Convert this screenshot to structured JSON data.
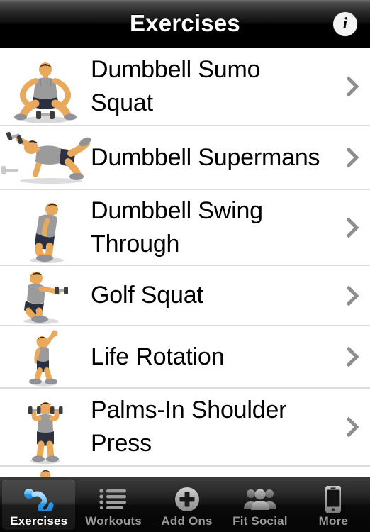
{
  "header": {
    "title": "Exercises",
    "info_button": {
      "name": "info-icon",
      "glyph": "i"
    }
  },
  "list": {
    "items": [
      {
        "title": "Dumbbell Sumo Squat",
        "thumbnail": "sumo-squat-figure",
        "accessory": "disclosure-chevron"
      },
      {
        "title": "Dumbbell Supermans",
        "thumbnail": "supermans-figure",
        "accessory": "disclosure-chevron"
      },
      {
        "title": "Dumbbell Swing Through",
        "thumbnail": "swing-through-figure",
        "accessory": "disclosure-chevron"
      },
      {
        "title": "Golf Squat",
        "thumbnail": "golf-squat-figure",
        "accessory": "disclosure-chevron"
      },
      {
        "title": "Life Rotation",
        "thumbnail": "life-rotation-figure",
        "accessory": "disclosure-chevron"
      },
      {
        "title": "Palms-In Shoulder Press",
        "thumbnail": "shoulder-press-figure",
        "accessory": "disclosure-chevron"
      }
    ]
  },
  "tabbar": {
    "selected": "Exercises",
    "tabs": [
      {
        "label": "Exercises",
        "icon": "sit-up-person-icon",
        "active": true
      },
      {
        "label": "Workouts",
        "icon": "bulleted-list-icon",
        "active": false
      },
      {
        "label": "Add Ons",
        "icon": "plus-circle-icon",
        "active": false
      },
      {
        "label": "Fit Social",
        "icon": "people-group-icon",
        "active": false
      },
      {
        "label": "More",
        "icon": "iphone-icon",
        "active": false
      }
    ]
  },
  "colors": {
    "accent": "#3aaaf0",
    "navbar": "#000000",
    "separator": "#dcdcdc",
    "chevron": "#8e8e8e",
    "tab_inactive_text": "#9a9a9a",
    "tab_active_text": "#ffffff",
    "skin": "#e8a95c",
    "shirt": "#9b9b9b",
    "shorts": "#2b3040"
  }
}
